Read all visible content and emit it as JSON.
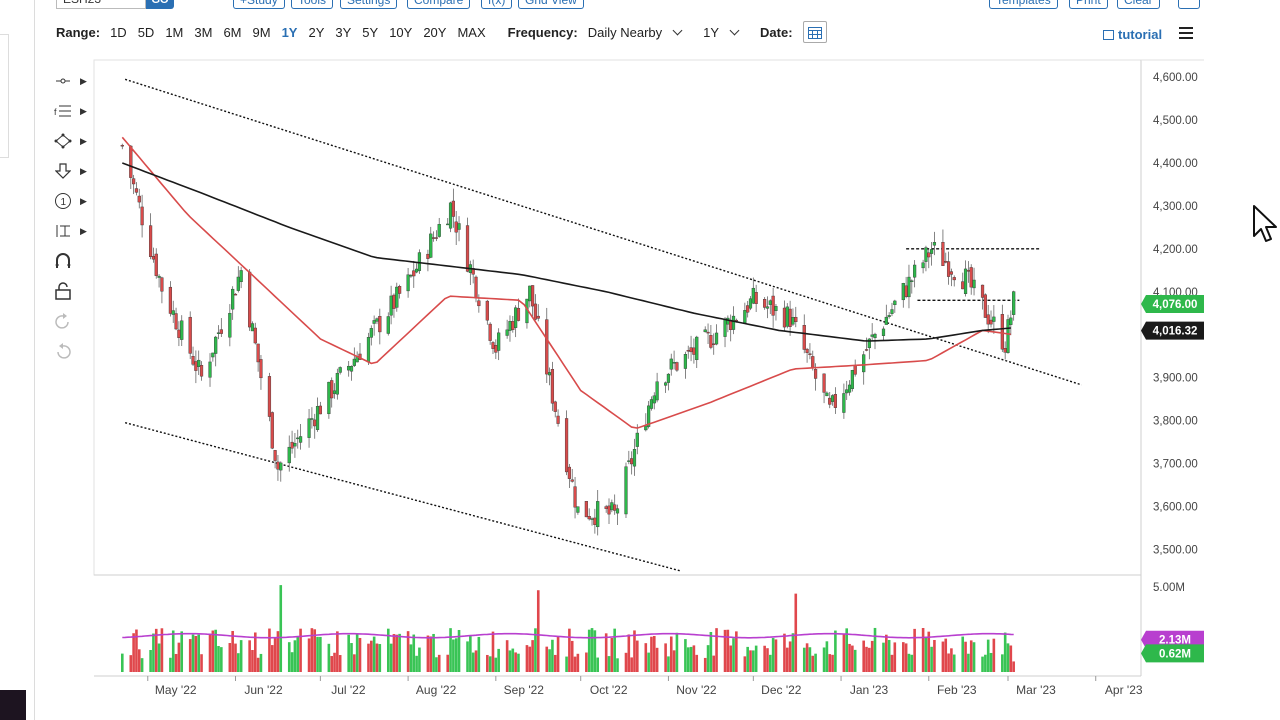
{
  "top_bar": {
    "symbol": "ESH23",
    "go": "GO",
    "buttons": [
      "+Study",
      "Tools",
      "Settings",
      "Compare",
      "f(x)",
      "Grid View"
    ],
    "right_buttons": [
      "Templates",
      "Print",
      "Clear"
    ]
  },
  "toolbar": {
    "range_label": "Range:",
    "ranges": [
      "1D",
      "5D",
      "1M",
      "3M",
      "6M",
      "9M",
      "1Y",
      "2Y",
      "3Y",
      "5Y",
      "10Y",
      "20Y",
      "MAX"
    ],
    "active_range": "1Y",
    "frequency_label": "Frequency:",
    "frequency_value": "Daily Nearby",
    "period_value": "1Y",
    "date_label": "Date:",
    "tutorial": "tutorial"
  },
  "drawing_tools": [
    "crosshair-tool-icon",
    "fibonacci-tool-icon",
    "shapes-tool-icon",
    "arrow-marker-tool-icon",
    "number-marker-tool-icon",
    "text-tool-icon",
    "magnet-icon",
    "lock-icon",
    "undo-icon",
    "redo-icon"
  ],
  "chart_data": [
    {
      "type": "candlestick",
      "title": "",
      "x_ticks": [
        "May '22",
        "Jun '22",
        "Jul '22",
        "Aug '22",
        "Sep '22",
        "Oct '22",
        "Nov '22",
        "Dec '22",
        "Jan '23",
        "Feb '23",
        "Mar '23",
        "Apr '23"
      ],
      "y_ticks": [
        "4,600.00",
        "4,500.00",
        "4,400.00",
        "4,300.00",
        "4,200.00",
        "4,100.00",
        "3,900.00",
        "3,800.00",
        "3,700.00",
        "3,600.00",
        "3,500.00"
      ],
      "ylim": [
        3440,
        4640
      ],
      "price_labels": [
        {
          "text": "4,076.00",
          "value": 4076,
          "color": "#2eb84b"
        },
        {
          "text": "4,016.32",
          "value": 4016.32,
          "color": "#1a1a1a"
        }
      ],
      "close_approx": {
        "dates": [
          "2022-04-22",
          "2022-05-06",
          "2022-05-20",
          "2022-06-03",
          "2022-06-16",
          "2022-07-08",
          "2022-08-01",
          "2022-08-16",
          "2022-09-01",
          "2022-09-13",
          "2022-09-30",
          "2022-10-13",
          "2022-10-28",
          "2022-11-10",
          "2022-12-01",
          "2022-12-14",
          "2022-12-28",
          "2023-01-13",
          "2023-02-02",
          "2023-02-14",
          "2023-02-28",
          "2023-03-03"
        ],
        "values": [
          4440,
          4110,
          3900,
          4150,
          3690,
          3900,
          4120,
          4300,
          3970,
          4100,
          3590,
          3580,
          3900,
          3960,
          4080,
          4040,
          3820,
          4000,
          4200,
          4130,
          3980,
          4076
        ]
      },
      "series": [
        {
          "name": "",
          "color": "#d84b4b",
          "dates": [
            "2022-04-22",
            "2022-05-15",
            "2022-06-10",
            "2022-07-01",
            "2022-07-20",
            "2022-08-15",
            "2022-09-10",
            "2022-10-01",
            "2022-10-20",
            "2022-11-15",
            "2022-12-15",
            "2023-01-10",
            "2023-02-01",
            "2023-02-20",
            "2023-03-03"
          ],
          "values": [
            4460,
            4280,
            4120,
            3990,
            3930,
            4090,
            4080,
            3870,
            3780,
            3840,
            3920,
            3930,
            3940,
            4010,
            4000
          ]
        },
        {
          "name": "",
          "color": "#1a1a1a",
          "dates": [
            "2022-04-22",
            "2022-05-20",
            "2022-06-20",
            "2022-07-20",
            "2022-08-15",
            "2022-09-10",
            "2022-10-10",
            "2022-11-10",
            "2022-12-10",
            "2023-01-10",
            "2023-02-01",
            "2023-02-20",
            "2023-03-03"
          ],
          "values": [
            4400,
            4330,
            4250,
            4180,
            4160,
            4140,
            4100,
            4050,
            4010,
            3985,
            3990,
            4010,
            4016
          ]
        }
      ],
      "trendlines": [
        {
          "name": "upper-channel",
          "style": "dotted",
          "from": [
            "2022-04-23",
            4595
          ],
          "to": [
            "2023-03-27",
            3883
          ]
        },
        {
          "name": "lower-channel",
          "style": "dotted",
          "from": [
            "2022-04-23",
            3795
          ],
          "to": [
            "2022-11-05",
            3450
          ]
        },
        {
          "name": "resistance",
          "style": "dashed",
          "from": [
            "2023-01-24",
            4200
          ],
          "to": [
            "2023-03-12",
            4200
          ]
        },
        {
          "name": "range-mid",
          "style": "dashed",
          "from": [
            "2023-01-28",
            4080
          ],
          "to": [
            "2023-03-05",
            4080
          ]
        }
      ]
    },
    {
      "type": "bar",
      "title": "",
      "ylabel": "",
      "y_ticks": [
        "5.00M"
      ],
      "ylim": [
        0,
        5.4
      ],
      "value_labels": [
        {
          "text": "2.13M",
          "value": 2.13,
          "color": "#b83fcf"
        },
        {
          "text": "0.62M",
          "value": 0.62,
          "color": "#2eb84b"
        }
      ],
      "volume_peaks": [
        {
          "date": "2022-06-17",
          "value": 5.1
        },
        {
          "date": "2022-09-16",
          "value": 4.8
        },
        {
          "date": "2022-12-16",
          "value": 4.6
        },
        {
          "date": "2023-03-03",
          "value": 0.62
        }
      ],
      "average_line": {
        "name": "",
        "value": 2.13,
        "color": "#b83fcf"
      }
    }
  ]
}
